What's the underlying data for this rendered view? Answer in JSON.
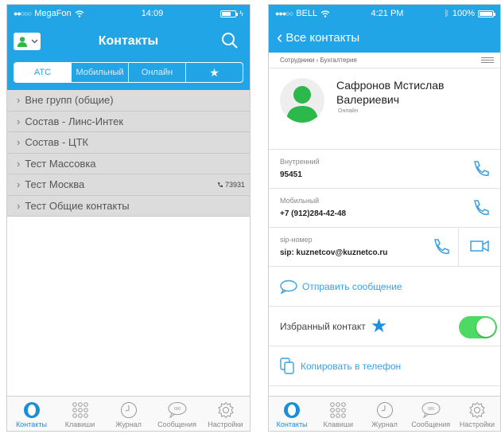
{
  "left": {
    "status": {
      "carrier": "MegaFon",
      "time": "14:09"
    },
    "title": "Контакты",
    "segments": [
      {
        "label": "АТС",
        "active": true
      },
      {
        "label": "Мобильный",
        "active": false
      },
      {
        "label": "Онлайн",
        "active": false
      },
      {
        "label": "★",
        "active": false
      }
    ],
    "groups": [
      {
        "label": "Вне групп (общие)"
      },
      {
        "label": "Состав - Линс-Интек"
      },
      {
        "label": "Состав - ЦТК"
      },
      {
        "label": "Тест Массовка"
      },
      {
        "label": "Тест Москва",
        "call_number": "73931"
      },
      {
        "label": "Тест Общие контакты"
      }
    ]
  },
  "right": {
    "status": {
      "carrier": "BELL",
      "time": "4:21 PM",
      "battery": "100%",
      "battery_level": 1.0
    },
    "back_label": "Все контакты",
    "breadcrumb": "Сотрудники › Бухгалтерия",
    "contact": {
      "name": "Сафронов Мстислав Валериевич",
      "status": "Онлайн"
    },
    "fields": {
      "internal": {
        "label": "Внутренний",
        "value": "95451"
      },
      "mobile": {
        "label": "Мобильный",
        "value": "+7 (912)284-42-48"
      },
      "sip": {
        "label": "sip-номер",
        "value": "sip: kuznetcov@kuznetco.ru"
      }
    },
    "send_message": "Отправить сообщение",
    "favorite": {
      "label": "Избранный контакт",
      "on": true
    },
    "copy_to_phone": "Копировать в телефон"
  },
  "tabs": [
    {
      "label": "Контакты",
      "icon": "contacts-icon",
      "active": true
    },
    {
      "label": "Клавиши",
      "icon": "keypad-icon",
      "active": false
    },
    {
      "label": "Журнал",
      "icon": "clock-icon",
      "active": false
    },
    {
      "label": "Сообщения",
      "icon": "chat-icon",
      "active": false
    },
    {
      "label": "Настройки",
      "icon": "gear-icon",
      "active": false
    }
  ],
  "colors": {
    "accent": "#22a5e6",
    "toggle_on": "#4cd964",
    "group_bg": "#dcdcdc"
  }
}
